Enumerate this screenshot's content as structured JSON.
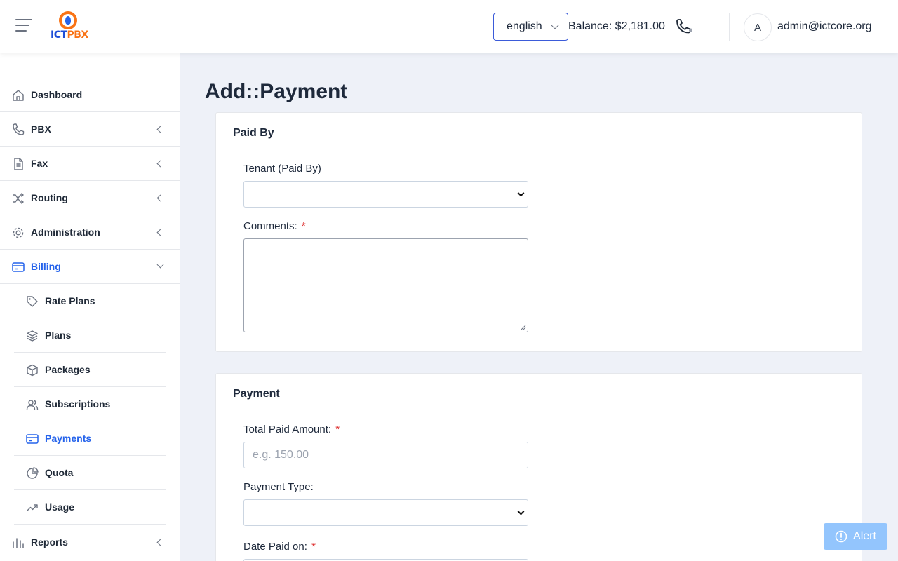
{
  "header": {
    "logo_text_a": "ICT",
    "logo_text_b": "PBX",
    "language": "english",
    "balance": "Balance: $2,181.00",
    "avatar_initial": "A",
    "user_email": "admin@ictcore.org"
  },
  "sidebar": {
    "items": [
      {
        "label": "Dashboard",
        "icon": "home-icon"
      },
      {
        "label": "PBX",
        "icon": "phone-icon"
      },
      {
        "label": "Fax",
        "icon": "document-icon"
      },
      {
        "label": "Routing",
        "icon": "shuffle-icon"
      },
      {
        "label": "Administration",
        "icon": "gear-icon"
      },
      {
        "label": "Billing",
        "icon": "credit-card-icon"
      },
      {
        "label": "Reports",
        "icon": "bar-chart-icon"
      }
    ],
    "billing_sub": [
      {
        "label": "Rate Plans",
        "icon": "tag-icon"
      },
      {
        "label": "Plans",
        "icon": "layers-icon"
      },
      {
        "label": "Packages",
        "icon": "box-icon"
      },
      {
        "label": "Subscriptions",
        "icon": "users-icon"
      },
      {
        "label": "Payments",
        "icon": "credit-card-icon"
      },
      {
        "label": "Quota",
        "icon": "pie-chart-icon"
      },
      {
        "label": "Usage",
        "icon": "trending-up-icon"
      }
    ]
  },
  "main": {
    "title": "Add::Payment",
    "paid_by_card": {
      "title": "Paid By",
      "tenant_label": "Tenant (Paid By)",
      "tenant_value": "",
      "comments_label": "Comments:",
      "comments_value": ""
    },
    "payment_card": {
      "title": "Payment",
      "amount_label": "Total Paid Amount:",
      "amount_placeholder": "e.g. 150.00",
      "type_label": "Payment Type:",
      "type_value": "",
      "date_label": "Date Paid on:"
    },
    "required_mark": "*"
  },
  "alert": {
    "label": "Alert",
    "icon": "alert-circle-icon"
  },
  "colors": {
    "accent": "#2563eb",
    "required": "#dc2626",
    "logo_orange": "#f97316"
  }
}
